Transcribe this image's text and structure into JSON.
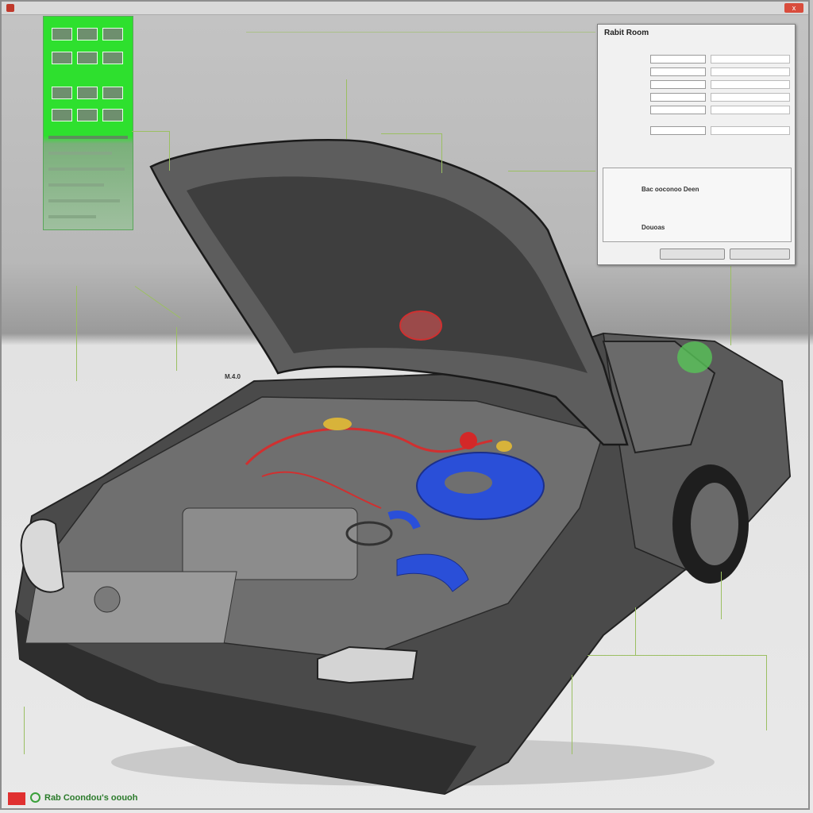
{
  "window": {
    "title": "",
    "right_text": "",
    "close_label": "x",
    "subtitle": ""
  },
  "left_panel": {
    "rows": [
      [
        "",
        "",
        ""
      ],
      [
        "",
        "",
        ""
      ],
      [
        "",
        "",
        ""
      ],
      [
        "",
        "",
        ""
      ]
    ]
  },
  "dialog": {
    "title": "Rabit Room",
    "subtitle": "",
    "rows": [
      {
        "label": "",
        "value": "",
        "value2": ""
      },
      {
        "label": "",
        "value": "",
        "value2": ""
      },
      {
        "label": "",
        "value": "",
        "value2": ""
      },
      {
        "label": "",
        "value": "",
        "value2": ""
      },
      {
        "label": "",
        "value": "",
        "value2": ""
      },
      {
        "label": "",
        "value": "",
        "value2": ""
      }
    ],
    "group": {
      "row1_label": "",
      "row1_value": "Bac ooconoo Deen",
      "row2_label": "",
      "row2_value": "",
      "row3_label": "",
      "row3_value": "Douoas"
    },
    "ok_label": "",
    "cancel_label": ""
  },
  "callouts": {
    "c1": "",
    "c2": "",
    "c3": "",
    "c4": "",
    "c5": "",
    "c6": "M.4.0",
    "c7": "",
    "c8": "",
    "c9": "",
    "c10": "",
    "c11": "",
    "c12": "",
    "c13": "",
    "c14": "",
    "c15": "",
    "c16": ""
  },
  "footer": {
    "logo_text": "",
    "brand": "Rab Coondou's oouoh",
    "tagline": ""
  },
  "colors": {
    "accent_green": "#2ee02e",
    "leader_line": "#9bbf62",
    "hose_blue": "#2a4fd8",
    "wire_red": "#d03030"
  }
}
